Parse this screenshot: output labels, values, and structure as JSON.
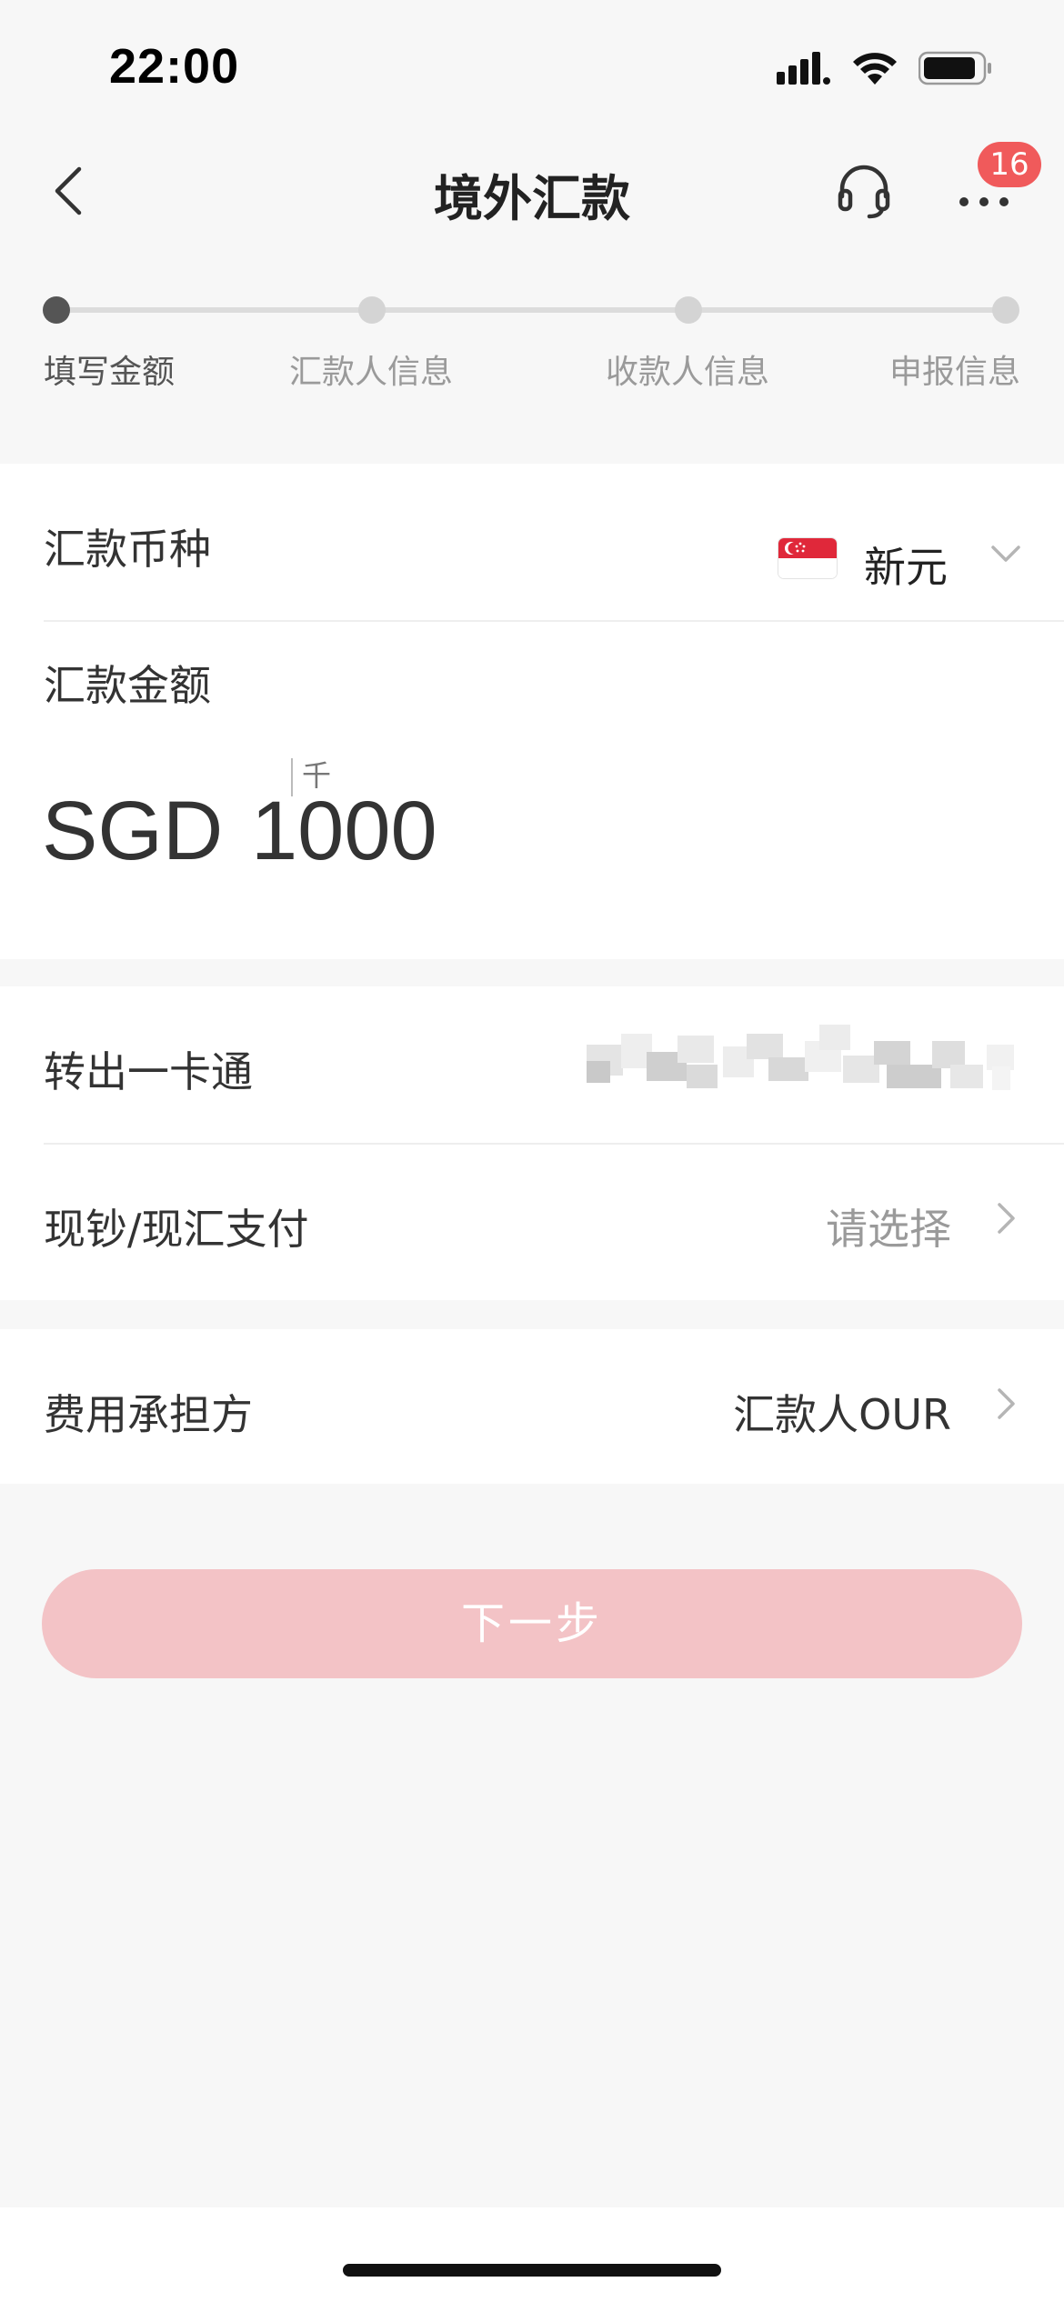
{
  "status_bar": {
    "time": "22:00"
  },
  "header": {
    "title": "境外汇款",
    "badge_count": "16",
    "icons": [
      "back-icon",
      "headset-icon",
      "more-icon"
    ]
  },
  "steps": [
    {
      "label": "填写金额",
      "active": true
    },
    {
      "label": "汇款人信息",
      "active": false
    },
    {
      "label": "收款人信息",
      "active": false
    },
    {
      "label": "申报信息",
      "active": false
    }
  ],
  "currency": {
    "label": "汇款币种",
    "value": "新元",
    "flag": "singapore-flag"
  },
  "amount": {
    "label": "汇款金额",
    "prefix": "SGD",
    "value": "1000",
    "unit_hint": "千"
  },
  "account": {
    "label": "转出一卡通"
  },
  "payment": {
    "label": "现钞/现汇支付",
    "placeholder": "请选择"
  },
  "fee": {
    "label": "费用承担方",
    "value": "汇款人OUR"
  },
  "next_button": {
    "label": "下一步",
    "enabled": false
  },
  "colors": {
    "background": "#f7f7f7",
    "card": "#ffffff",
    "badge": "#f05a5b",
    "button_disabled": "#f3c3c6",
    "step_active": "#555555",
    "step_inactive": "#d4d4d4"
  }
}
